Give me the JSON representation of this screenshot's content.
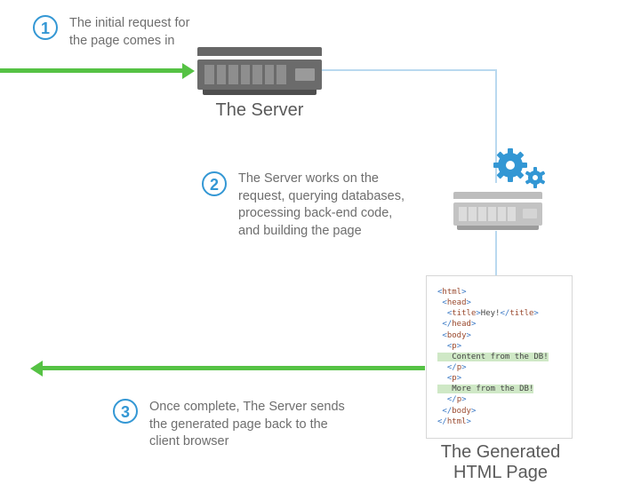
{
  "steps": [
    {
      "num": "1",
      "text": "The initial request for\nthe page comes in"
    },
    {
      "num": "2",
      "text": "The Server works on the\nrequest, querying databases,\nprocessing back-end code,\nand building the page"
    },
    {
      "num": "3",
      "text": "Once complete, The Server sends\nthe generated page back to the\nclient browser"
    }
  ],
  "labels": {
    "server": "The Server",
    "generated": "The Generated\nHTML Page"
  },
  "code": {
    "l01a": "<",
    "l01b": "html",
    "l01c": ">",
    "l02a": " <",
    "l02b": "head",
    "l02c": ">",
    "l03a": "  <",
    "l03b": "title",
    "l03c": ">",
    "l03d": "Hey!",
    "l03e": "</",
    "l03f": "title",
    "l03g": ">",
    "l04a": " </",
    "l04b": "head",
    "l04c": ">",
    "l05a": " <",
    "l05b": "body",
    "l05c": ">",
    "l06a": "  <",
    "l06b": "p",
    "l06c": ">",
    "l07": "   Content from the DB!",
    "l08a": "  </",
    "l08b": "p",
    "l08c": ">",
    "l09a": "  <",
    "l09b": "p",
    "l09c": ">",
    "l10": "   More from the DB!",
    "l11a": "  </",
    "l11b": "p",
    "l11c": ">",
    "l12a": " </",
    "l12b": "body",
    "l12c": ">",
    "l13a": "</",
    "l13b": "html",
    "l13c": ">"
  }
}
